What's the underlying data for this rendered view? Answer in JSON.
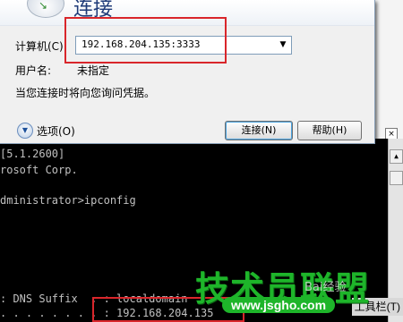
{
  "dialog": {
    "title": "连接",
    "computer_label": "计算机(C):",
    "computer_value": "192.168.204.135:3333",
    "username_label": "用户名:",
    "username_value": "未指定",
    "notice": "当您连接时将向您询问凭据。",
    "options_label": "选项(O)",
    "connect_button": "连接(N)",
    "help_button": "帮助(H)"
  },
  "console": {
    "lines": [
      "[5.1.2600]",
      "rosoft Corp.",
      "dministrator>ipconfig",
      ": DNS Suffix  . : localdomain",
      ". . . . . . . . : 192.168.204.135"
    ]
  },
  "background": {
    "toolbar_hint": "工具栏(T)",
    "close_glyph": "×"
  },
  "watermark": {
    "title": "技术员联盟",
    "url": "www.jsgho.com",
    "baidu": "Bai经验"
  },
  "colors": {
    "highlight": "#d9262b",
    "watermark_green": "#1eb52a"
  }
}
